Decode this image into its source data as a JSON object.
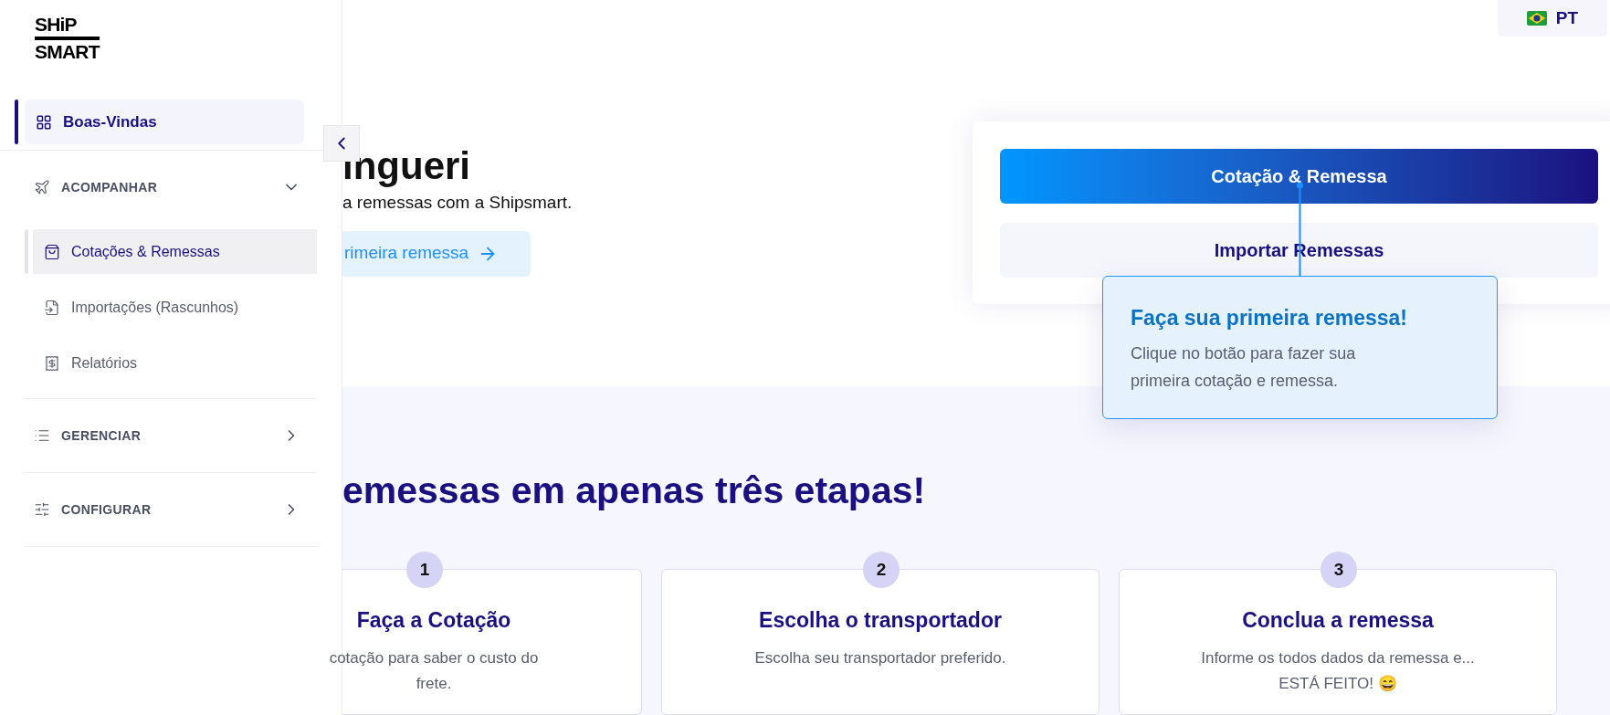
{
  "logo": {
    "line1": "SHiP",
    "line2": "SMART"
  },
  "sidebar": {
    "items": [
      {
        "kind": "link",
        "label": "Boas-Vindas",
        "selected": true
      },
      {
        "kind": "section",
        "label": "ACOMPANHAR",
        "expanded": true,
        "children": [
          {
            "label": "Cotações & Remessas",
            "selected": true
          },
          {
            "label": "Importações (Rascunhos)",
            "selected": false
          },
          {
            "label": "Relatórios",
            "selected": false
          }
        ]
      },
      {
        "kind": "section",
        "label": "GERENCIAR",
        "expanded": false
      },
      {
        "kind": "section",
        "label": "CONFIGURAR",
        "expanded": false
      }
    ]
  },
  "language": {
    "label": "PT"
  },
  "hero": {
    "title": "ingueri",
    "subtitle": "a remessas com a Shipsmart.",
    "cta": "rimeira remessa"
  },
  "actions": {
    "primary": "Cotação & Remessa",
    "secondary": "Importar Remessas"
  },
  "tooltip": {
    "title": "Faça sua primeira remessa!",
    "body": "Clique no botão para fazer sua primeira cotação e remessa."
  },
  "steps": {
    "heading": "emessas em apenas três etapas!",
    "items": [
      {
        "number": "1",
        "title": "Faça a Cotação",
        "description": "cotação para saber o custo do frete."
      },
      {
        "number": "2",
        "title": "Escolha o transportador",
        "description": "Escolha seu transportador preferido."
      },
      {
        "number": "3",
        "title": "Conclua a remessa",
        "description": "Informe os todos dados da remessa e... ESTÁ FEITO! 😄"
      }
    ]
  }
}
